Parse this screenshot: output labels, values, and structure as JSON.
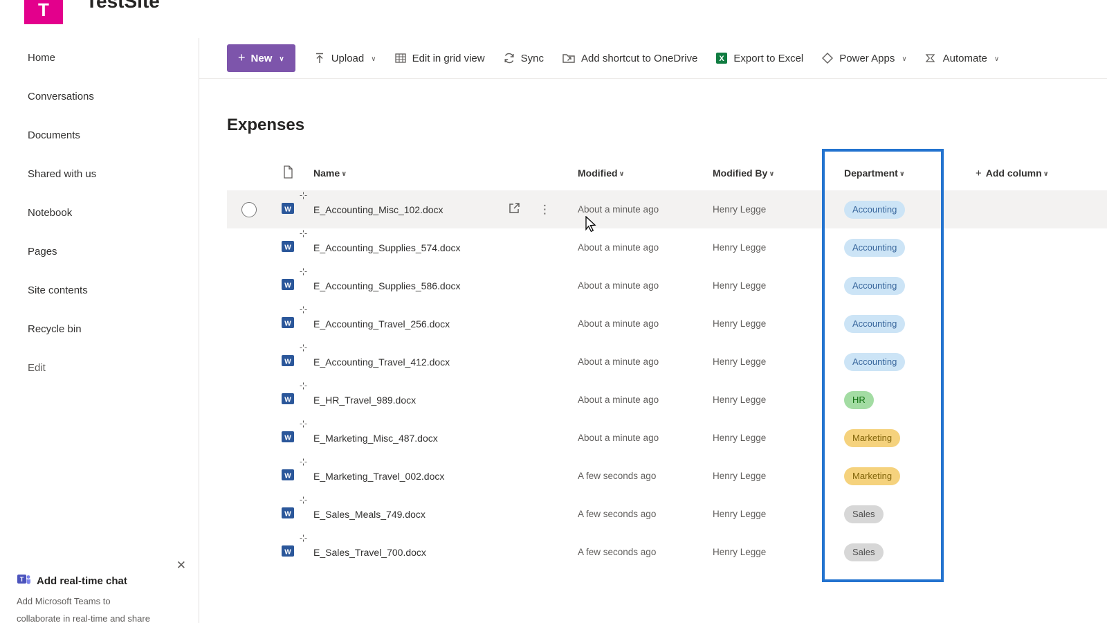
{
  "header": {
    "site_title": "TestSite",
    "logo_letter": "T"
  },
  "sidebar": {
    "items": [
      {
        "label": "Home"
      },
      {
        "label": "Conversations"
      },
      {
        "label": "Documents"
      },
      {
        "label": "Shared with us"
      },
      {
        "label": "Notebook"
      },
      {
        "label": "Pages"
      },
      {
        "label": "Site contents"
      },
      {
        "label": "Recycle bin"
      },
      {
        "label": "Edit",
        "muted": true
      }
    ],
    "promo": {
      "title": "Add real-time chat",
      "line1": "Add Microsoft Teams to",
      "line2": "collaborate in real-time and share"
    }
  },
  "toolbar": {
    "new_button": {
      "label": "New"
    },
    "items": [
      {
        "label": "Upload",
        "icon": "upload-icon",
        "chevron": true
      },
      {
        "label": "Edit in grid view",
        "icon": "grid-view-icon",
        "chevron": false
      },
      {
        "label": "Sync",
        "icon": "sync-icon",
        "chevron": false
      },
      {
        "label": "Add shortcut to OneDrive",
        "icon": "onedrive-shortcut-icon",
        "chevron": false
      },
      {
        "label": "Export to Excel",
        "icon": "excel-icon",
        "chevron": false
      },
      {
        "label": "Power Apps",
        "icon": "power-apps-icon",
        "chevron": true
      },
      {
        "label": "Automate",
        "icon": "automate-icon",
        "chevron": true
      }
    ]
  },
  "page": {
    "title": "Expenses"
  },
  "table": {
    "columns": {
      "name": "Name",
      "modified": "Modified",
      "modified_by": "Modified By",
      "department": "Department",
      "add_column": "Add column"
    },
    "rows": [
      {
        "name": "E_Accounting_Misc_102.docx",
        "modified": "About a minute ago",
        "modified_by": "Henry Legge",
        "department": "Accounting",
        "selected_hover": true
      },
      {
        "name": "E_Accounting_Supplies_574.docx",
        "modified": "About a minute ago",
        "modified_by": "Henry Legge",
        "department": "Accounting"
      },
      {
        "name": "E_Accounting_Supplies_586.docx",
        "modified": "About a minute ago",
        "modified_by": "Henry Legge",
        "department": "Accounting"
      },
      {
        "name": "E_Accounting_Travel_256.docx",
        "modified": "About a minute ago",
        "modified_by": "Henry Legge",
        "department": "Accounting"
      },
      {
        "name": "E_Accounting_Travel_412.docx",
        "modified": "About a minute ago",
        "modified_by": "Henry Legge",
        "department": "Accounting"
      },
      {
        "name": "E_HR_Travel_989.docx",
        "modified": "About a minute ago",
        "modified_by": "Henry Legge",
        "department": "HR"
      },
      {
        "name": "E_Marketing_Misc_487.docx",
        "modified": "About a minute ago",
        "modified_by": "Henry Legge",
        "department": "Marketing"
      },
      {
        "name": "E_Marketing_Travel_002.docx",
        "modified": "A few seconds ago",
        "modified_by": "Henry Legge",
        "department": "Marketing"
      },
      {
        "name": "E_Sales_Meals_749.docx",
        "modified": "A few seconds ago",
        "modified_by": "Henry Legge",
        "department": "Sales"
      },
      {
        "name": "E_Sales_Travel_700.docx",
        "modified": "A few seconds ago",
        "modified_by": "Henry Legge",
        "department": "Sales"
      }
    ]
  },
  "department_styles": {
    "Accounting": {
      "bg": "#cce4f6",
      "text": "#38669c"
    },
    "HR": {
      "bg": "#a3dca3",
      "text": "#0e6f0e"
    },
    "Marketing": {
      "bg": "#f5d27d",
      "text": "#82650a"
    },
    "Sales": {
      "bg": "#d7d7d7",
      "text": "#4d4d4d"
    }
  },
  "colors": {
    "new_button_bg": "#7d55ab",
    "excel_green": "#107c41",
    "annotation_blue": "#2373cf",
    "site_logo_pink": "#e3008c",
    "word_icon_blue": "#2b579a"
  },
  "icons": {
    "chevron_down": "∨",
    "more_options": "⋮",
    "close": "✕",
    "plus": "+"
  }
}
